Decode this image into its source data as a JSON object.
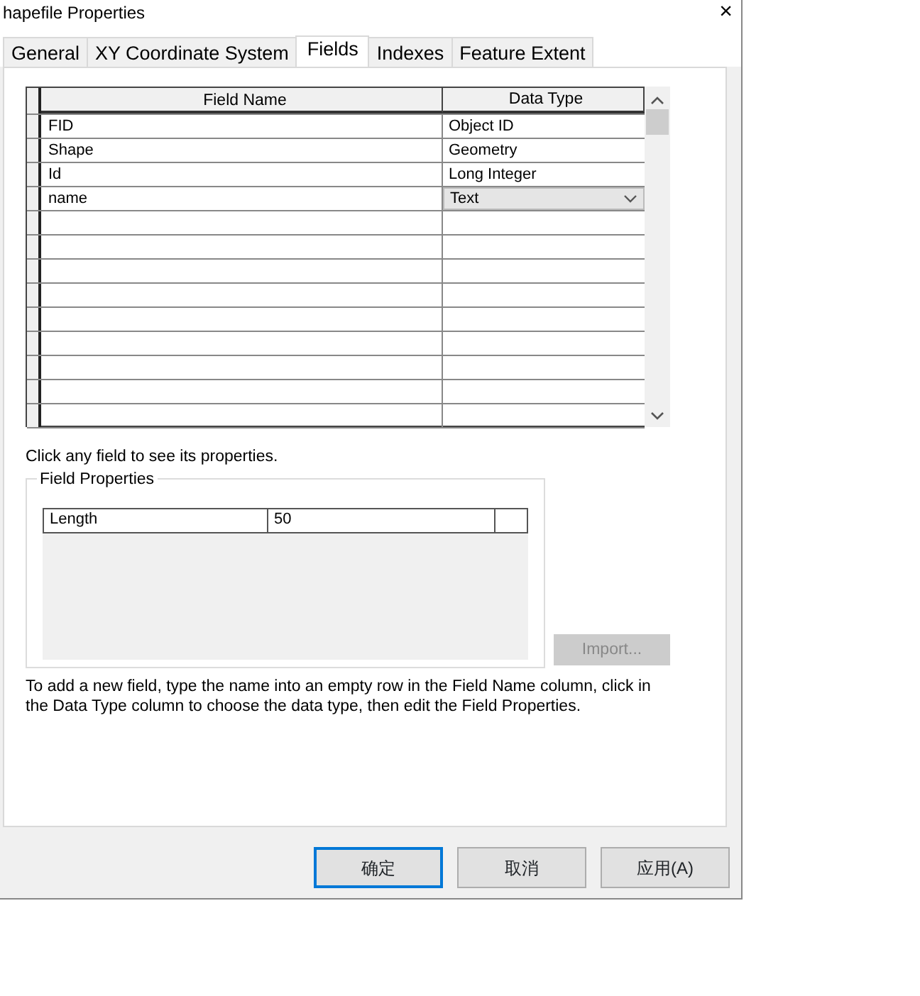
{
  "window": {
    "title": "hapefile Properties",
    "close": "×"
  },
  "tabs": [
    {
      "label": "General",
      "selected": false
    },
    {
      "label": "XY Coordinate System",
      "selected": false
    },
    {
      "label": "Fields",
      "selected": true
    },
    {
      "label": "Indexes",
      "selected": false
    },
    {
      "label": "Feature Extent",
      "selected": false
    }
  ],
  "fields_table": {
    "columns": [
      "Field Name",
      "Data Type"
    ],
    "rows": [
      {
        "field_name": "FID",
        "data_type": "Object ID",
        "kind": "plain"
      },
      {
        "field_name": "Shape",
        "data_type": "Geometry",
        "kind": "plain"
      },
      {
        "field_name": "Id",
        "data_type": "Long Integer",
        "kind": "plain"
      },
      {
        "field_name": "name",
        "data_type": "Text",
        "kind": "dropdown"
      }
    ]
  },
  "hint": "Click any field to see its properties.",
  "field_properties": {
    "title": "Field Properties",
    "rows": [
      {
        "name": "Length",
        "value": "50"
      }
    ]
  },
  "import_button": {
    "label": "Import...",
    "disabled": true
  },
  "help_text": "To add a new field, type the name into an empty row in the Field Name column, click in the Data Type column to choose the data type, then edit the Field Properties.",
  "buttons": [
    {
      "label": "确定",
      "default": true
    },
    {
      "label": "取消",
      "default": false
    },
    {
      "label": "应用(A)",
      "default": false
    }
  ]
}
